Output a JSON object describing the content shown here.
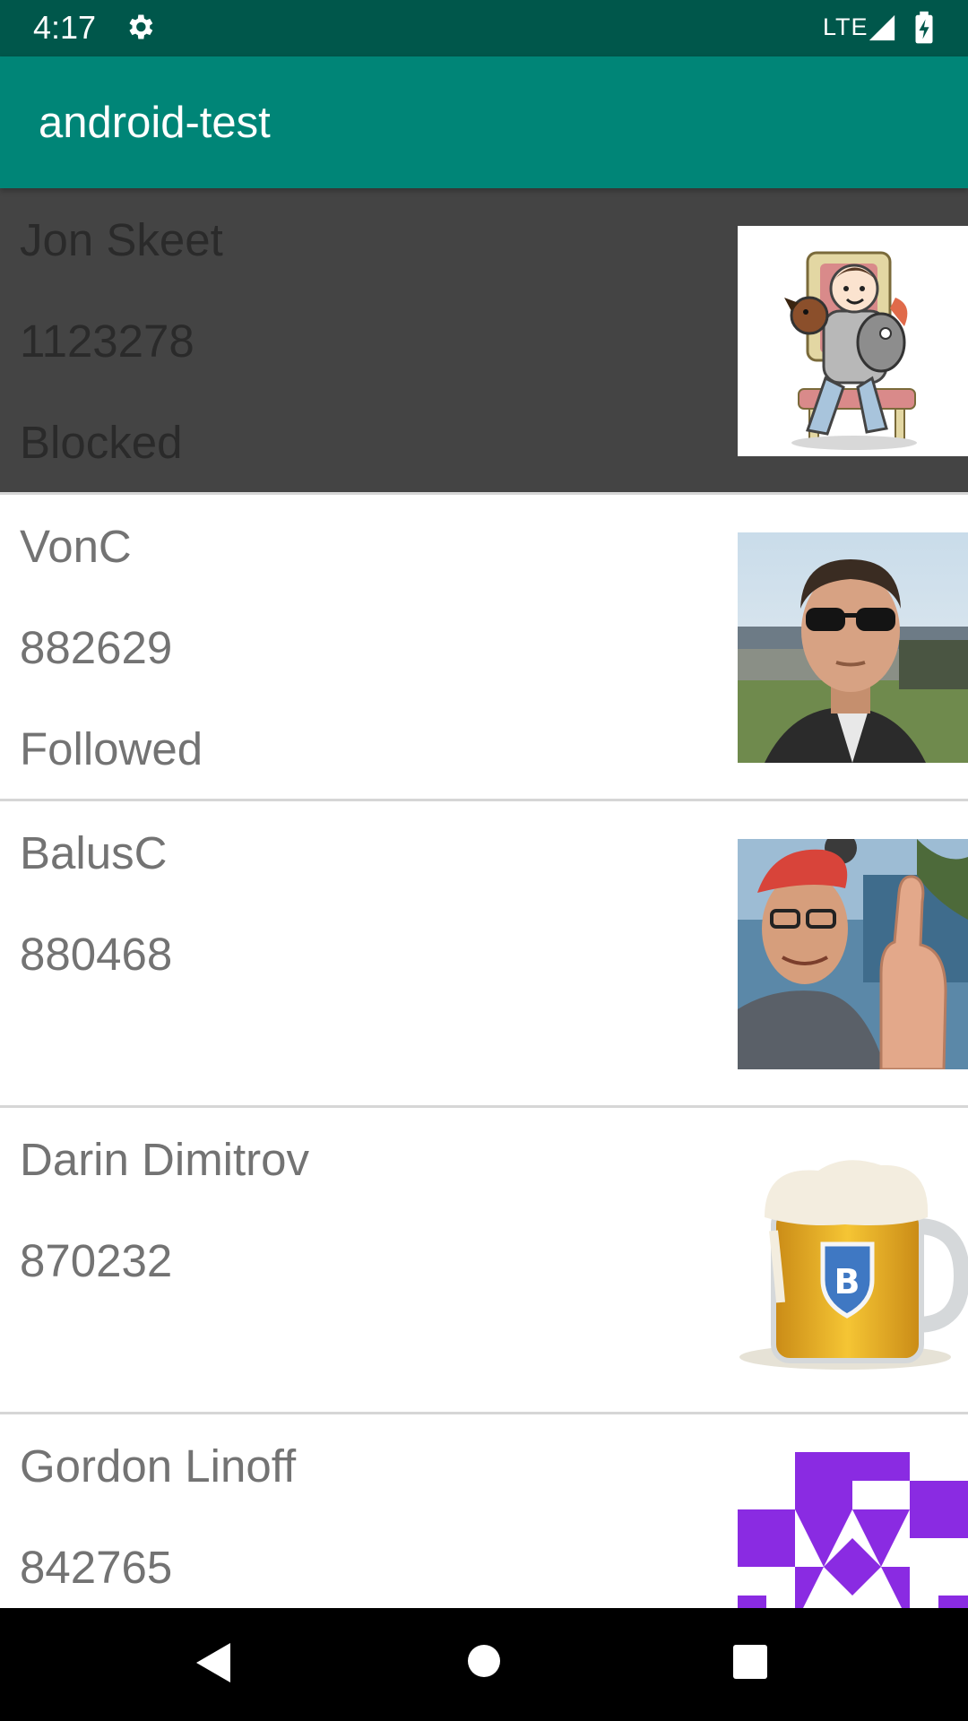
{
  "status_bar": {
    "time": "4:17",
    "network": "LTE",
    "settings_icon": "gear-icon",
    "signal_icon": "cell-signal-icon",
    "battery_icon": "battery-charging-icon"
  },
  "app_bar": {
    "title": "android-test",
    "color": "#008577",
    "status_color": "#00574b"
  },
  "users": [
    {
      "name": "Jon Skeet",
      "reputation": "1123278",
      "status": "Blocked",
      "avatar": "cartoon-avatar",
      "highlighted": true
    },
    {
      "name": "VonC",
      "reputation": "882629",
      "status": "Followed",
      "avatar": "photo-avatar-sunglasses"
    },
    {
      "name": "BalusC",
      "reputation": "880468",
      "status": "",
      "avatar": "photo-avatar-thumbs-up"
    },
    {
      "name": "Darin Dimitrov",
      "reputation": "870232",
      "status": "",
      "avatar": "beer-mug-avatar"
    },
    {
      "name": "Gordon Linoff",
      "reputation": "842765",
      "status": "",
      "avatar": "identicon-avatar"
    }
  ],
  "nav_bar": {
    "back_icon": "back-triangle-icon",
    "home_icon": "home-circle-icon",
    "recents_icon": "recents-square-icon"
  },
  "colors": {
    "blocked_row": "#444444",
    "text": "#737373",
    "divider": "#d6d6d6",
    "identicon": "#8a2be2"
  }
}
